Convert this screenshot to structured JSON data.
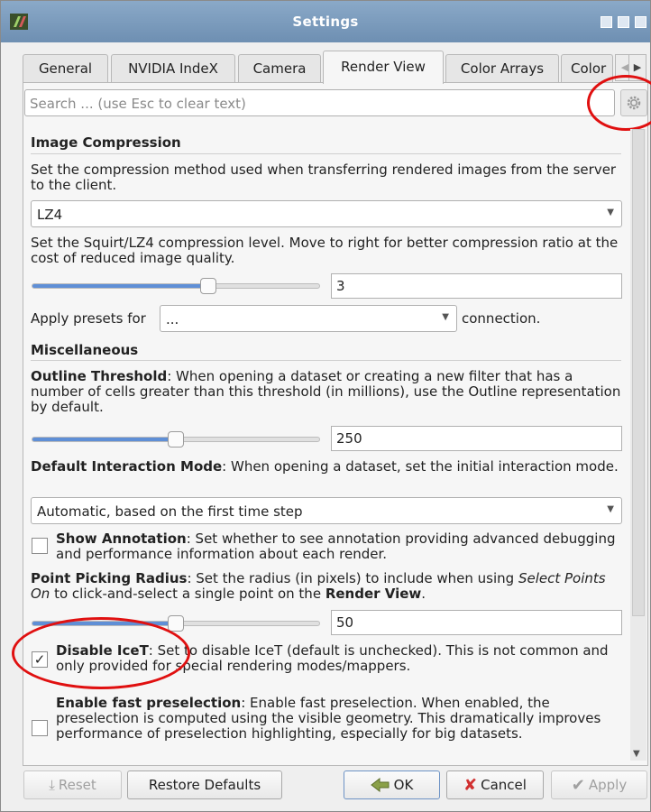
{
  "window": {
    "title": "Settings"
  },
  "tabs": [
    {
      "label": "General"
    },
    {
      "label": "NVIDIA IndeX"
    },
    {
      "label": "Camera"
    },
    {
      "label": "Render View"
    },
    {
      "label": "Color Arrays"
    },
    {
      "label": "Color"
    }
  ],
  "search": {
    "placeholder": "Search ... (use Esc to clear text)"
  },
  "image_compression": {
    "heading": "Image Compression",
    "desc": "Set the compression method used when transferring rendered images from the server to the client.",
    "method": "LZ4",
    "level_desc": "Set the Squirt/LZ4 compression level. Move to right for better compression ratio at the cost of reduced image quality.",
    "level_value": "3",
    "level_fraction": 0.62,
    "presets_label": "Apply presets for",
    "presets_value": "...",
    "presets_suffix": "connection."
  },
  "misc": {
    "heading": "Miscellaneous",
    "outline_label": "Outline Threshold",
    "outline_desc": ": When opening a dataset or creating a new filter that has a number of cells greater than this threshold (in millions), use the Outline representation by default.",
    "outline_value": "250",
    "outline_fraction": 0.5,
    "interaction_label": "Default Interaction Mode",
    "interaction_desc": ": When opening a dataset, set the initial interaction mode.",
    "interaction_value": "Automatic, based on the first time step",
    "annotation_label": "Show Annotation",
    "annotation_desc": ": Set whether to see annotation providing advanced debugging and performance information about each render.",
    "annotation_checked": false,
    "picking_label": "Point Picking Radius",
    "picking_desc_a": ": Set the radius (in pixels) to include when using ",
    "picking_desc_b": "Select Points On",
    "picking_desc_c": " to click-and-select a single point on the ",
    "picking_desc_d": "Render View",
    "picking_desc_e": ".",
    "picking_value": "50",
    "picking_fraction": 0.5,
    "icet_label": "Disable IceT",
    "icet_desc": ": Set to disable IceT (default is unchecked). This is not common and only provided for special rendering modes/mappers.",
    "icet_checked": true,
    "icet_mark": "✓",
    "presel_label": "Enable fast preselection",
    "presel_desc": ": Enable fast preselection. When enabled, the preselection is computed using the visible geometry. This dramatically improves performance of preselection highlighting, especially for big datasets.",
    "presel_checked": false
  },
  "buttons": {
    "reset": "Reset",
    "restore": "Restore Defaults",
    "ok": "OK",
    "cancel": "Cancel",
    "apply": "Apply"
  },
  "colors": {
    "accent": "#5f8fd6",
    "highlight_ring": "#e01010",
    "titlebar": "#7b9cbf"
  }
}
